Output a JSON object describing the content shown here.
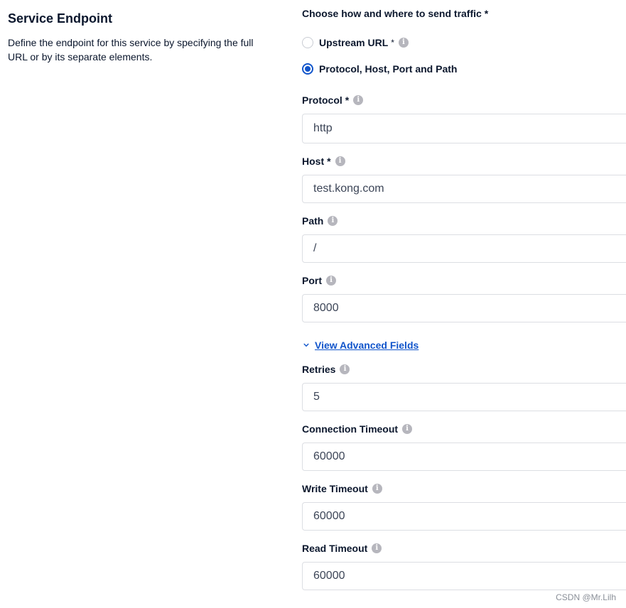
{
  "section": {
    "title": "Service Endpoint",
    "description": "Define the endpoint for this service by specifying the full URL or by its separate elements."
  },
  "traffic": {
    "label": "Choose how and where to send traffic *",
    "options": [
      {
        "label": "Upstream URL",
        "required": "*",
        "selected": false
      },
      {
        "label": "Protocol, Host, Port and Path",
        "selected": true
      }
    ]
  },
  "fields": {
    "protocol": {
      "label": "Protocol",
      "required": "*",
      "value": "http"
    },
    "host": {
      "label": "Host",
      "required": "*",
      "value": "test.kong.com"
    },
    "path": {
      "label": "Path",
      "value": "/"
    },
    "port": {
      "label": "Port",
      "value": "8000"
    }
  },
  "advanced": {
    "toggle_label": "View Advanced Fields"
  },
  "advanced_fields": {
    "retries": {
      "label": "Retries",
      "value": "5"
    },
    "connection_timeout": {
      "label": "Connection Timeout",
      "value": "60000"
    },
    "write_timeout": {
      "label": "Write Timeout",
      "value": "60000"
    },
    "read_timeout": {
      "label": "Read Timeout",
      "value": "60000"
    }
  },
  "info_glyph": "i",
  "watermark": "CSDN @Mr.Lilh",
  "colors": {
    "accent": "#1155cb",
    "info_icon": "#b6b6bd",
    "border": "#dcdee3"
  }
}
